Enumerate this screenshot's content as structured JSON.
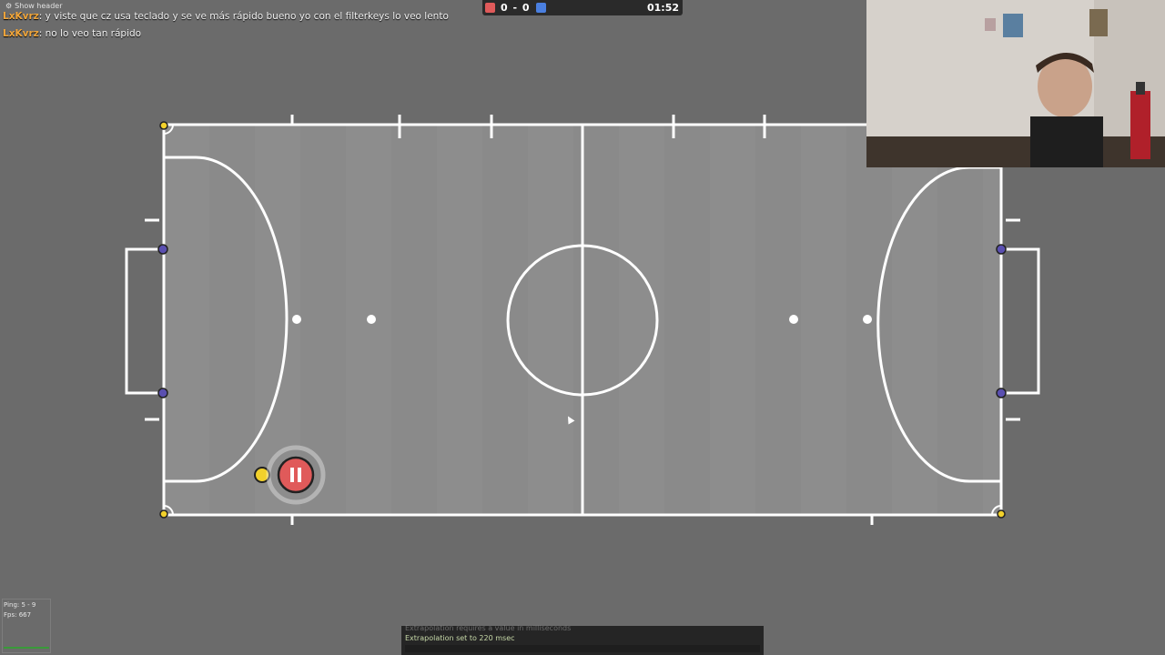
{
  "chat": {
    "show_header": "Show header",
    "messages": [
      {
        "name": "LxKvrz",
        "text": ": y viste que cz usa teclado y se ve más rápido bueno yo con el filterkeys lo veo lento"
      },
      {
        "name": "LxKvrz",
        "text": ": no lo veo tan rápido"
      }
    ]
  },
  "scoreboard": {
    "red_score": "0",
    "separator": "-",
    "blue_score": "0",
    "timer": "01:52",
    "red_color": "#e05a5a",
    "blue_color": "#4a7fe0"
  },
  "field": {
    "grass_color": "#8c8c8c",
    "line_color": "#ffffff",
    "goal_post_color": "#5a4fb0",
    "corner_color": "#f2d12b"
  },
  "players": {
    "red_player_icon": "pause-icon",
    "red_player_color": "#e05a5a",
    "ball_color": "#f2d12b"
  },
  "stats": {
    "ping": "Ping: 5 - 9",
    "fps": "Fps: 667"
  },
  "console": {
    "previous": "Extrapolation requires a value in milliseconds",
    "message": "Extrapolation set to 220 msec"
  }
}
